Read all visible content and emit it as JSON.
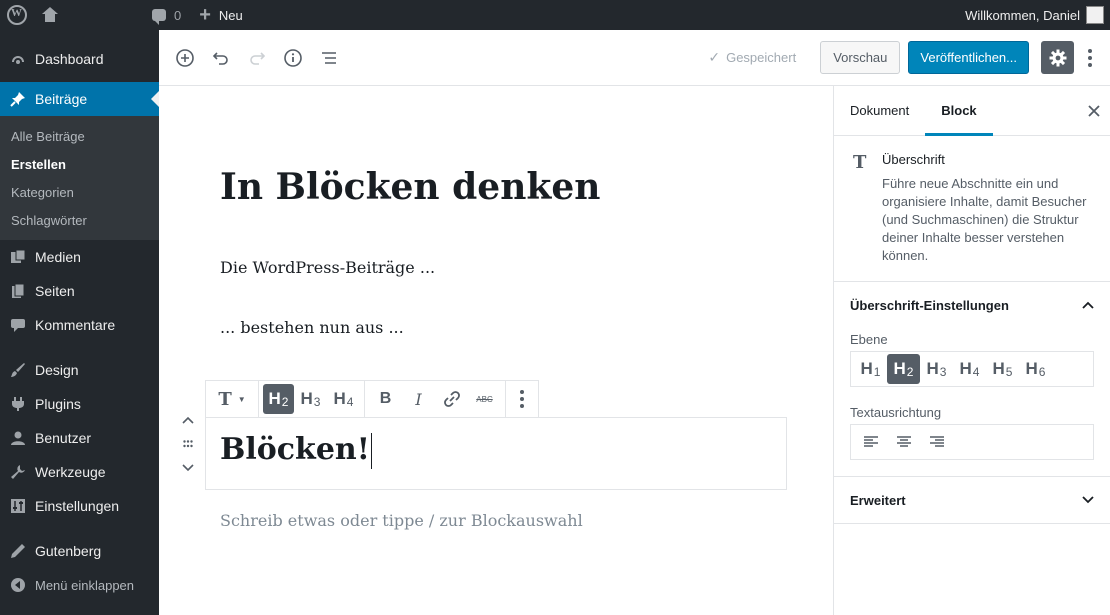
{
  "adminbar": {
    "comments_count": "0",
    "new_label": "Neu",
    "welcome": "Willkommen, Daniel"
  },
  "sidebar": {
    "items": [
      {
        "label": "Dashboard",
        "icon": "dashboard-icon"
      },
      {
        "label": "Beiträge",
        "icon": "pin-icon",
        "active": true
      },
      {
        "label": "Medien",
        "icon": "media-icon"
      },
      {
        "label": "Seiten",
        "icon": "pages-icon"
      },
      {
        "label": "Kommentare",
        "icon": "comments-icon"
      },
      {
        "label": "Design",
        "icon": "brush-icon"
      },
      {
        "label": "Plugins",
        "icon": "plugin-icon"
      },
      {
        "label": "Benutzer",
        "icon": "user-icon"
      },
      {
        "label": "Werkzeuge",
        "icon": "wrench-icon"
      },
      {
        "label": "Einstellungen",
        "icon": "settings-icon"
      },
      {
        "label": "Gutenberg",
        "icon": "pencil-icon"
      },
      {
        "label": "Menü einklappen",
        "icon": "collapse-icon"
      }
    ],
    "submenu": [
      {
        "label": "Alle Beiträge"
      },
      {
        "label": "Erstellen",
        "current": true
      },
      {
        "label": "Kategorien"
      },
      {
        "label": "Schlagwörter"
      }
    ]
  },
  "header": {
    "saved_label": "Gespeichert",
    "preview_label": "Vorschau",
    "publish_label": "Veröffentlichen..."
  },
  "content": {
    "title": "In Blöcken denken",
    "paragraph1": "Die WordPress-Beiträge ...",
    "paragraph2": "... bestehen nun aus ...",
    "heading_block": "Blöcken!",
    "placeholder": "Schreib etwas oder tippe / zur Blockauswahl",
    "toolbar": {
      "transform_label": "T",
      "h2": "H",
      "h2_sub": "2",
      "h3": "H",
      "h3_sub": "3",
      "h4": "H",
      "h4_sub": "4",
      "bold": "B",
      "italic": "I",
      "strike": "ABC"
    }
  },
  "panel": {
    "tabs": [
      "Dokument",
      "Block"
    ],
    "block_title": "Überschrift",
    "block_desc": "Führe neue Abschnitte ein und organisiere Inhalte, damit Besucher (und Suchmaschinen) die Struktur deiner Inhalte besser verstehen können.",
    "heading_settings": "Überschrift-Einstellungen",
    "level_label": "Ebene",
    "levels": [
      "1",
      "2",
      "3",
      "4",
      "5",
      "6"
    ],
    "level_prefix": "H",
    "align_label": "Textausrichtung",
    "advanced": "Erweitert"
  },
  "colors": {
    "admin_bg": "#23282d",
    "accent": "#0073aa",
    "publish": "#0085ba"
  }
}
